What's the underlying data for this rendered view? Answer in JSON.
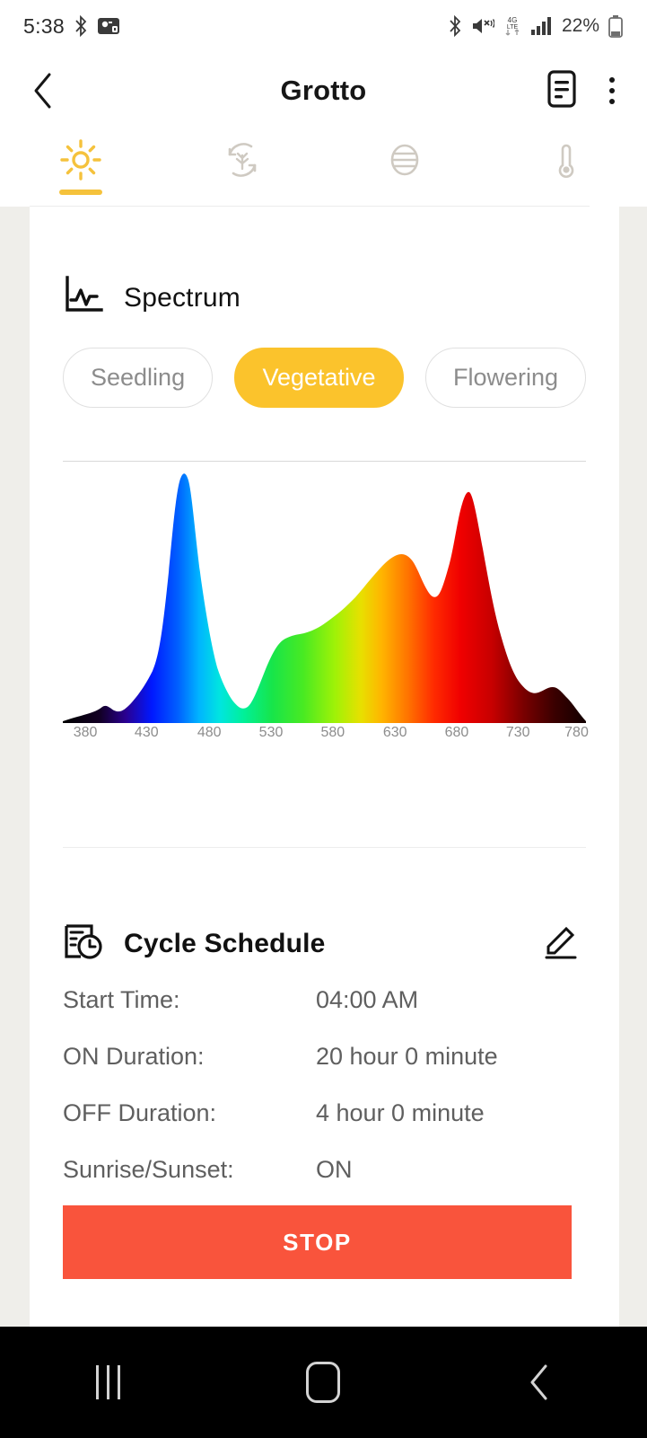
{
  "status_bar": {
    "time": "5:38",
    "battery_percent": "22%",
    "icons": [
      "bluetooth-icon",
      "qr-lock-icon",
      "bluetooth-icon",
      "mute-vibrate-icon",
      "data-4g-lte-icon",
      "signal-bars-icon",
      "battery-icon"
    ]
  },
  "app_bar": {
    "title": "Grotto",
    "back_icon": "back-chevron-icon",
    "notes_icon": "document-notes-icon",
    "overflow_icon": "overflow-menu-icon"
  },
  "tabs": [
    {
      "id": "light",
      "icon": "sun-icon",
      "active": true
    },
    {
      "id": "grow-cycle",
      "icon": "leaf-cycle-icon",
      "active": false
    },
    {
      "id": "airflow",
      "icon": "vent-fan-icon",
      "active": false
    },
    {
      "id": "temperature",
      "icon": "thermometer-icon",
      "active": false
    }
  ],
  "spectrum": {
    "title": "Spectrum",
    "icon": "line-chart-icon",
    "modes": [
      {
        "label": "Seedling",
        "selected": false
      },
      {
        "label": "Vegetative",
        "selected": true
      },
      {
        "label": "Flowering",
        "selected": false
      }
    ]
  },
  "chart_data": {
    "type": "area",
    "title": "Spectrum",
    "xlabel": "",
    "ylabel": "",
    "xlim": [
      380,
      780
    ],
    "ylim": [
      0,
      1
    ],
    "grid": false,
    "legend": "none",
    "tick_labels": [
      "380",
      "430",
      "480",
      "530",
      "580",
      "630",
      "680",
      "730",
      "780"
    ],
    "ticks": [
      380,
      430,
      480,
      530,
      580,
      630,
      680,
      730,
      780
    ],
    "fill": "wavelength-spectrum-gradient",
    "x": [
      380,
      390,
      400,
      410,
      415,
      420,
      425,
      430,
      435,
      440,
      445,
      450,
      455,
      460,
      465,
      470,
      475,
      480,
      485,
      490,
      495,
      500,
      505,
      510,
      520,
      530,
      540,
      550,
      560,
      570,
      580,
      590,
      600,
      610,
      620,
      630,
      640,
      645,
      650,
      655,
      660,
      665,
      670,
      675,
      680,
      690,
      700,
      710,
      720,
      730,
      740,
      750,
      760,
      770,
      780
    ],
    "values": [
      0.02,
      0.03,
      0.04,
      0.05,
      0.06,
      0.08,
      0.14,
      0.35,
      0.68,
      0.93,
      1.0,
      0.86,
      0.62,
      0.44,
      0.32,
      0.24,
      0.17,
      0.12,
      0.1,
      0.13,
      0.2,
      0.3,
      0.38,
      0.42,
      0.44,
      0.46,
      0.5,
      0.54,
      0.58,
      0.63,
      0.68,
      0.73,
      0.78,
      0.81,
      0.8,
      0.75,
      0.7,
      0.69,
      0.7,
      0.74,
      0.82,
      0.9,
      0.96,
      0.93,
      0.8,
      0.55,
      0.36,
      0.25,
      0.18,
      0.14,
      0.12,
      0.13,
      0.12,
      0.07,
      0.02
    ]
  },
  "cycle_schedule": {
    "title": "Cycle Schedule",
    "icon": "calendar-clock-icon",
    "edit_icon": "edit-pencil-icon",
    "rows": [
      {
        "label": "Start Time:",
        "value": "04:00 AM"
      },
      {
        "label": "ON Duration:",
        "value": "20 hour 0 minute"
      },
      {
        "label": "OFF Duration:",
        "value": "4 hour 0 minute"
      },
      {
        "label": "Sunrise/Sunset:",
        "value": "ON"
      }
    ],
    "stop_button": "STOP"
  },
  "nav_bar": {
    "recents_icon": "recent-apps-icon",
    "home_icon": "home-icon",
    "back_icon": "nav-back-icon"
  },
  "colors": {
    "accent_yellow": "#FBC32C",
    "tab_active": "#F5C23C",
    "stop_red": "#F9543C",
    "page_bg": "#EFEEEA"
  }
}
